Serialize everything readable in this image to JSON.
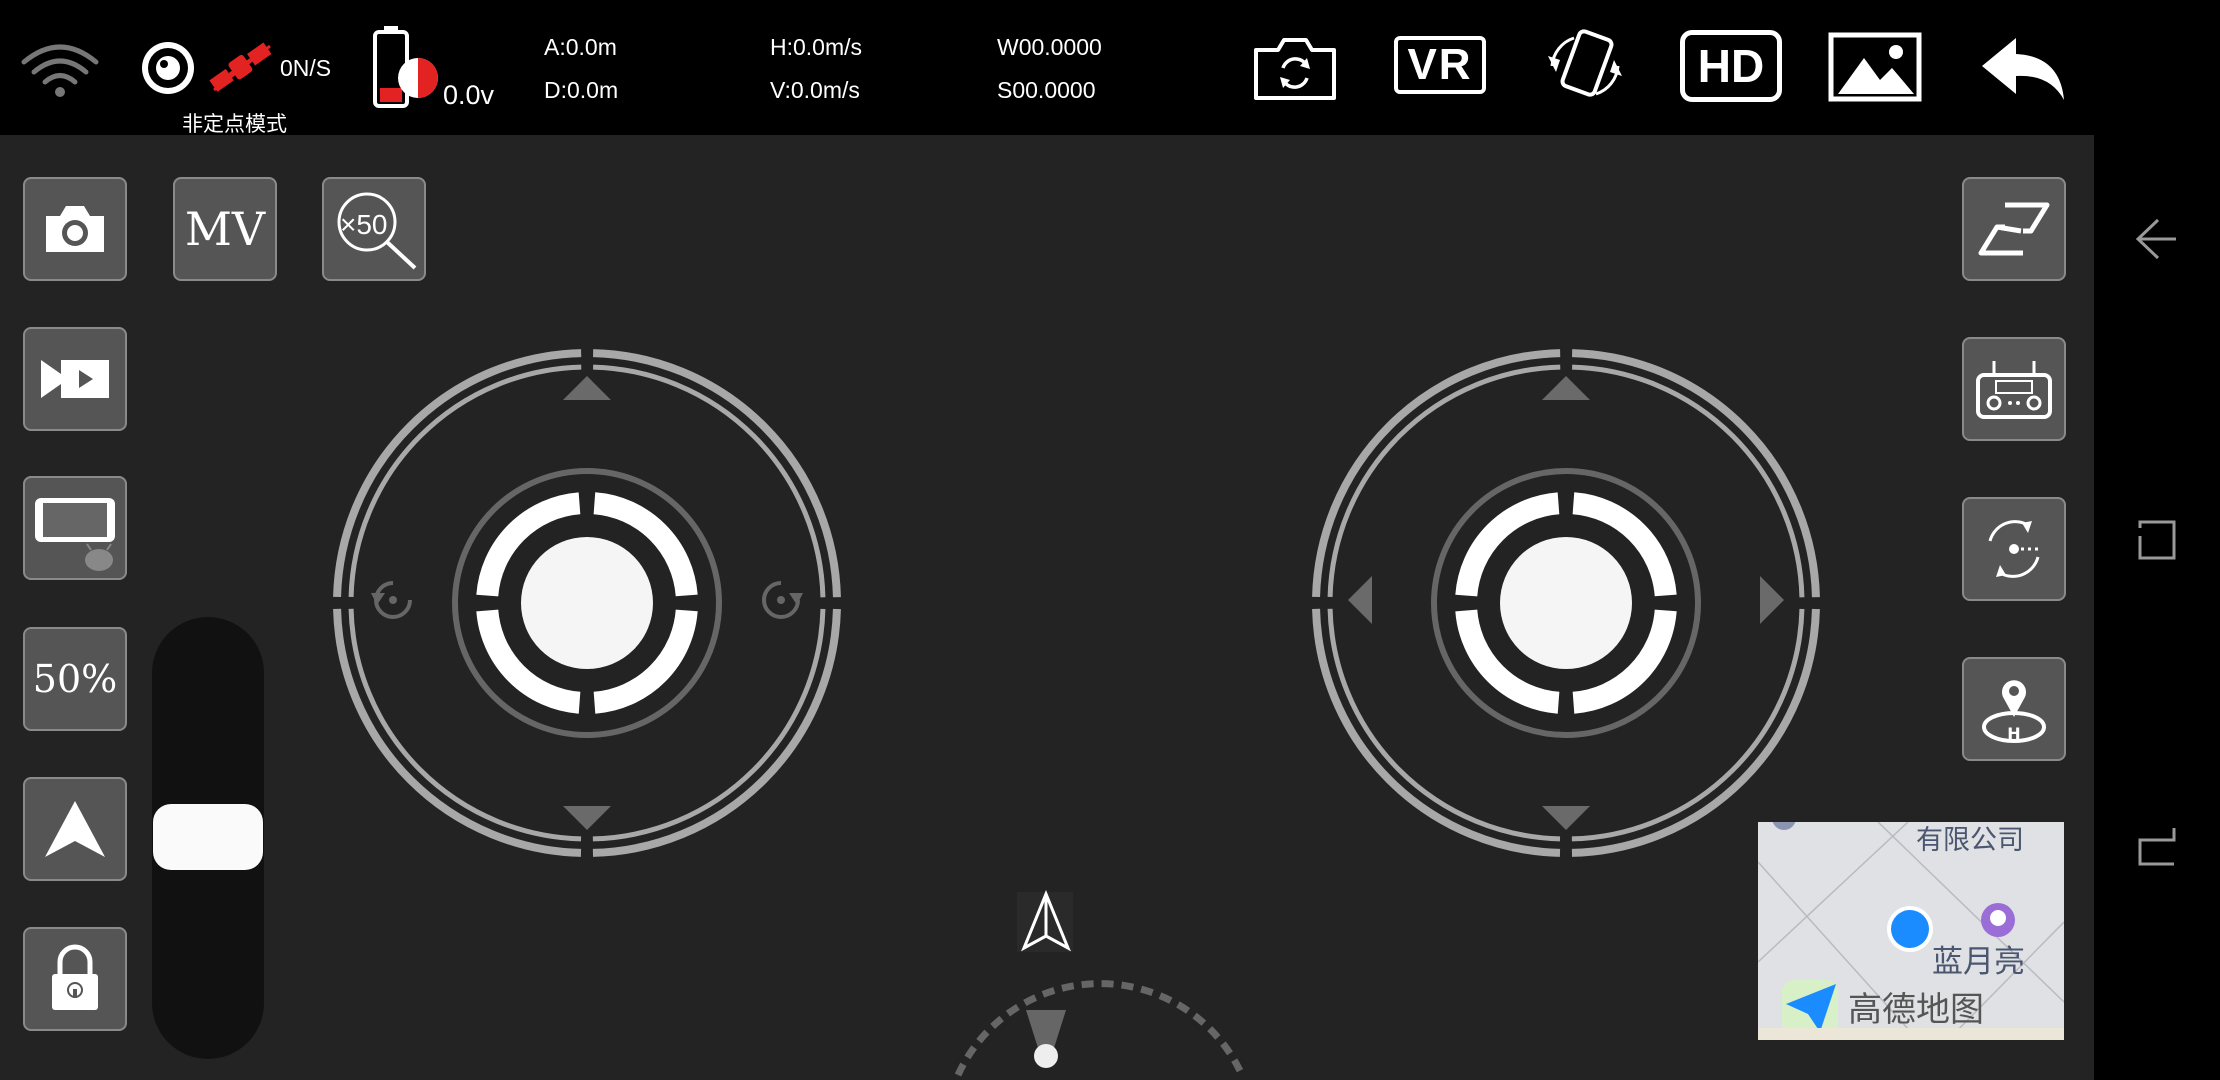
{
  "status": {
    "gps_speed": "0N/S",
    "mode_label": "非定点模式",
    "battery_voltage": "0.0v",
    "altitude": "A:0.0m",
    "distance": "D:0.0m",
    "h_speed": "H:0.0m/s",
    "v_speed": "V:0.0m/s",
    "longitude": "W00.0000",
    "latitude": "S00.0000"
  },
  "toolbar": {
    "vr_label": "VR",
    "hd_label": "HD"
  },
  "left_buttons": {
    "mv_label": "MV",
    "zoom_label": "×50",
    "speed_label": "50%"
  },
  "map": {
    "label_company": "有限公司",
    "label_place": "蓝月亮",
    "brand": "高德地图"
  },
  "colors": {
    "accent_red": "#e32222",
    "button_bg": "#555555",
    "ring_gray": "#a8a8a8",
    "location_dot": "#1a8cff"
  },
  "icons": {
    "wifi": "wifi-icon",
    "camera_switch": "camera-switch-icon",
    "rotate_screen": "rotate-screen-icon",
    "gallery": "gallery-icon",
    "back": "back-arrow-icon"
  }
}
